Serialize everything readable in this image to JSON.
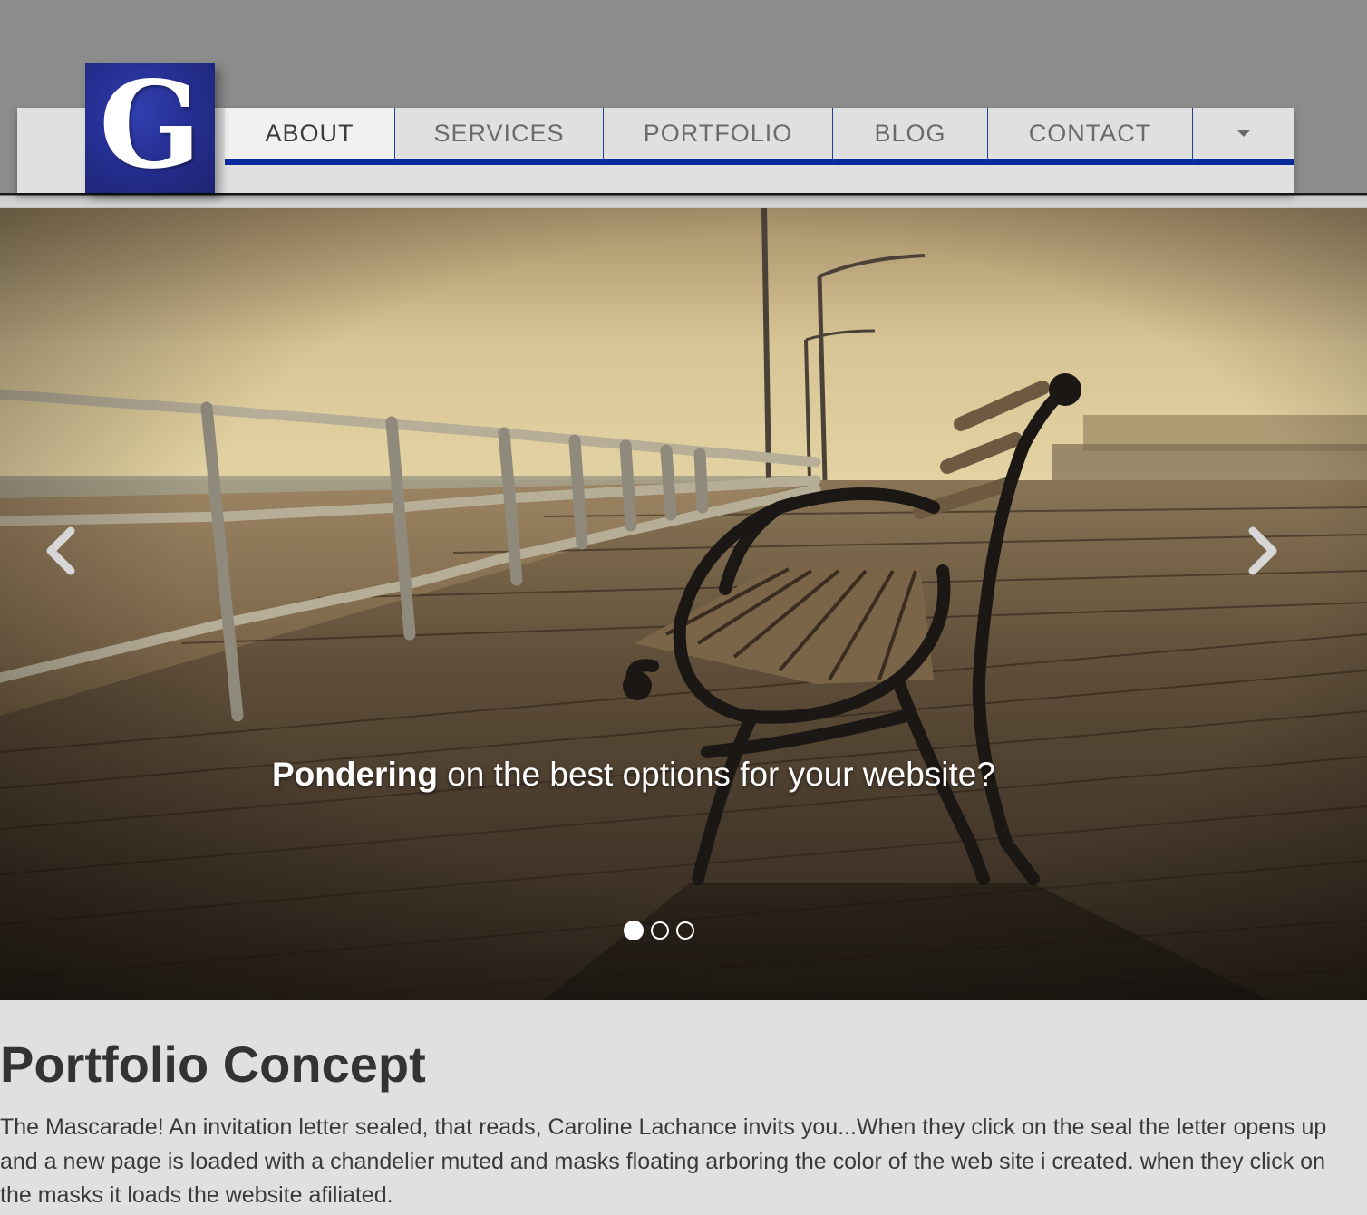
{
  "logo": {
    "letter": "G"
  },
  "nav": {
    "items": [
      {
        "label": "ABOUT",
        "active": true
      },
      {
        "label": "SERVICES",
        "active": false
      },
      {
        "label": "PORTFOLIO",
        "active": false
      },
      {
        "label": "BLOG",
        "active": false
      },
      {
        "label": "CONTACT",
        "active": false
      }
    ],
    "more_icon": "chevron-down-icon"
  },
  "hero": {
    "caption_bold": "Pondering",
    "caption_rest": " on the best options for your website?",
    "prev_icon": "chevron-left-icon",
    "next_icon": "chevron-right-icon",
    "slide_count": 3,
    "active_slide": 1
  },
  "content": {
    "title": "Portfolio Concept",
    "body": "The Mascarade! An invitation letter sealed, that reads, Caroline Lachance invits you...When they click on the seal the letter opens up and a new page is loaded with a chandelier muted and masks floating arboring the color of the web site i created. when they click on the masks it loads the website afiliated."
  },
  "colors": {
    "header_band": "#8c8c8c",
    "nav_background": "#e0e0e0",
    "nav_accent": "#0a2b9e",
    "logo_blue": "#262f93",
    "page_background": "#e0e0e0",
    "text": "#333333"
  }
}
